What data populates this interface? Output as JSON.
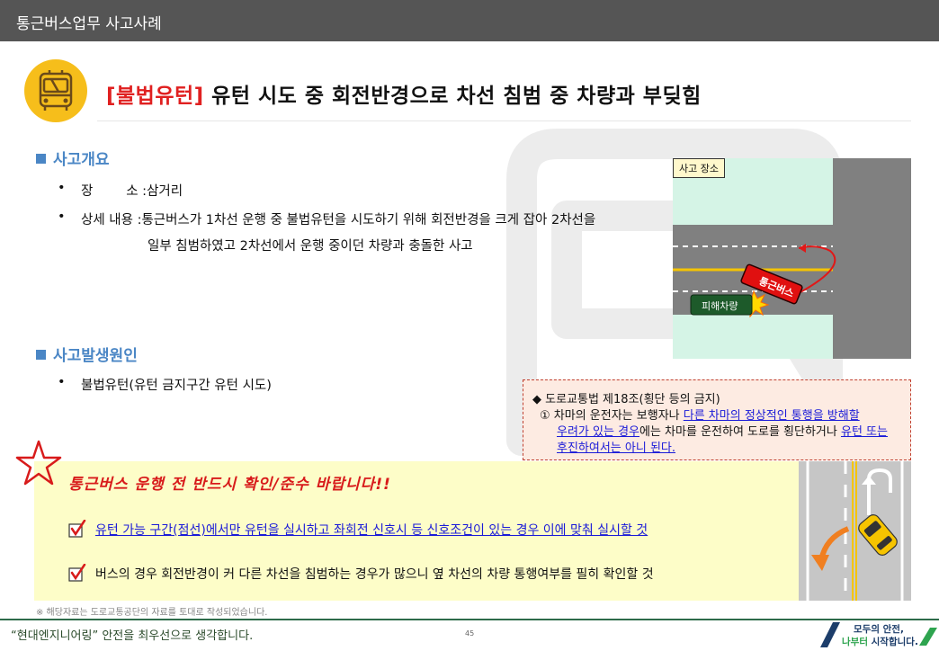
{
  "header": {
    "title": "통근버스업무 사고사례"
  },
  "headline": {
    "tag": "[불법유턴]",
    "text": " 유턴 시도 중 회전반경으로 차선 침범 중 차량과 부딪힘"
  },
  "icons": {
    "bus": "bus-icon",
    "star": "star-icon",
    "check": "checkbox-check-icon"
  },
  "colors": {
    "accent_blue": "#4a86c5",
    "alert_red": "#d81b1b",
    "logo_yellow": "#f6be1b",
    "footer_green": "#2d6b4a"
  },
  "overview": {
    "title": "사고개요",
    "items": [
      {
        "label": "장        소 :",
        "value": "삼거리"
      },
      {
        "label": "상세 내용 :",
        "value": "통근버스가 1차선 운행 중 불법유턴을 시도하기 위해 회전반경을 크게 잡아 2차선을",
        "value2": "일부 침범하였고 2차선에서 운행 중이던 차량과 충돌한 사고"
      }
    ]
  },
  "cause": {
    "title": "사고발생원인",
    "items": [
      "불법유턴(유턴 금지구간 유턴 시도)"
    ]
  },
  "location": {
    "label": "사고 장소",
    "bus_label": "통근버스",
    "victim_label": "피해차량"
  },
  "law": {
    "title": "◆ 도로교통법 제18조(횡단 등의 금지)",
    "l1_a": "① 차마의 운전자는 보행자나 ",
    "l1_b": "다른 차마의 정상적인 통행을 방해할",
    "l2_a": "우려가 있는 경우",
    "l2_b": "에는 차마를 운전하여 도로를 횡단하거나 ",
    "l2_c": "유턴 또는",
    "l3": "후진하여서는 아니 된다."
  },
  "notice": {
    "title": "통근버스 운행 전 반드시 확인/준수 바랍니다!!",
    "items": [
      "유턴 가능 구간(점선)에서만 유턴을 실시하고 좌회전 신호시 등 신호조건이 있는 경우 이에 맞춰 실시할 것",
      "버스의 경우 회전반경이 커 다른 차선을 침범하는 경우가 많으니 옆 차선의 차량 통행여부를 필히 확인할 것"
    ]
  },
  "footnote": "※ 해당자료는 도로교통공단의 자료를 토대로 작성되었습니다.",
  "footer": {
    "left": "“현대엔지니어링” 안전을 최우선으로 생각합니다.",
    "page": "45",
    "right_1": "모두의 안전,",
    "right_2a": "나부터",
    "right_2b": " 시작합니다."
  }
}
